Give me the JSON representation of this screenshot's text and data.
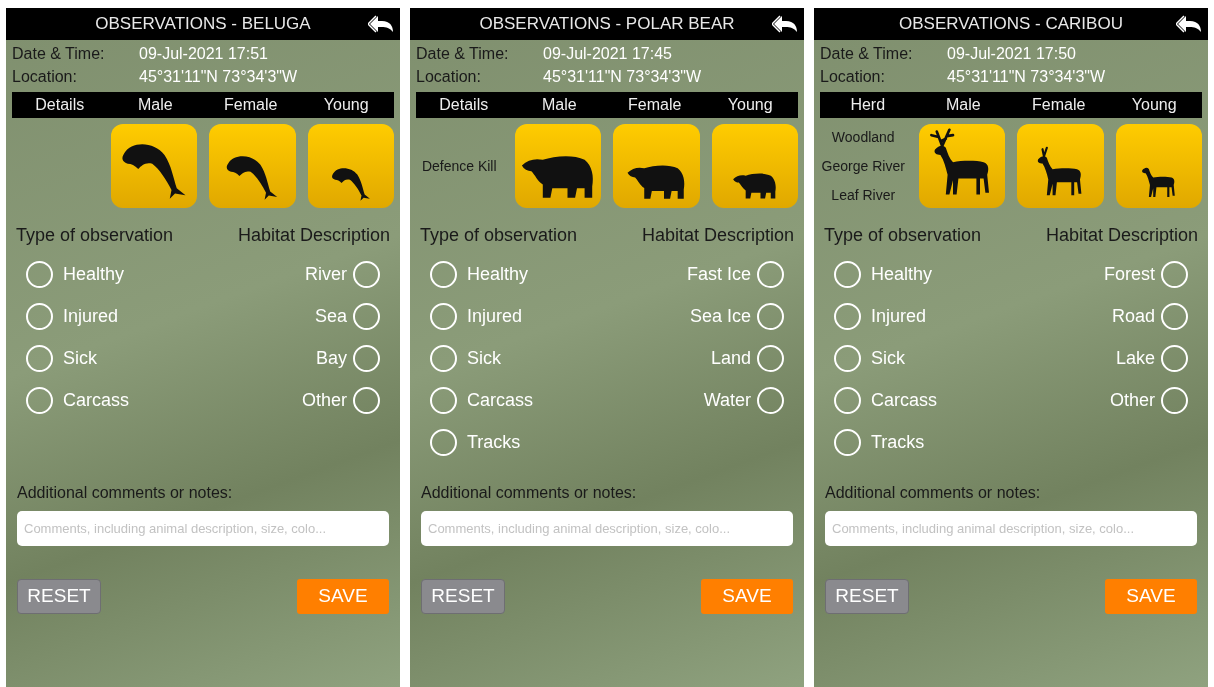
{
  "panels": [
    {
      "title": "OBSERVATIONS - BELUGA",
      "date_label": "Date & Time:",
      "date_value": "09-Jul-2021 17:51",
      "location_label": "Location:",
      "location_value": "45°31'11\"N 73°34'3\"W",
      "columns": [
        "Details",
        "Male",
        "Female",
        "Young"
      ],
      "icons": [
        {
          "kind": "whale"
        },
        {
          "kind": "whale"
        },
        {
          "kind": "whale"
        }
      ],
      "observation_heading": "Type of observation",
      "habitat_heading": "Habitat Description",
      "observation_options": [
        {
          "label": "Healthy",
          "selected": false
        },
        {
          "label": "Injured",
          "selected": false
        },
        {
          "label": "Sick",
          "selected": false
        },
        {
          "label": "Carcass",
          "selected": false
        }
      ],
      "habitat_options": [
        {
          "label": "River",
          "selected": false
        },
        {
          "label": "Sea",
          "selected": false
        },
        {
          "label": "Bay",
          "selected": false
        },
        {
          "label": "Other",
          "selected": false
        }
      ],
      "notes_label": "Additional comments or notes:",
      "notes_placeholder": "Comments, including animal description, size, colo...",
      "reset": "RESET",
      "save": "SAVE"
    },
    {
      "title": "OBSERVATIONS - POLAR BEAR",
      "date_label": "Date & Time:",
      "date_value": "09-Jul-2021 17:45",
      "location_label": "Location:",
      "location_value": "45°31'11\"N 73°34'3\"W",
      "columns": [
        "Details",
        "Male",
        "Female",
        "Young"
      ],
      "details": [
        "Defence Kill"
      ],
      "icons": [
        {
          "kind": "bear"
        },
        {
          "kind": "bear"
        },
        {
          "kind": "bear"
        }
      ],
      "observation_heading": "Type of observation",
      "habitat_heading": "Habitat Description",
      "observation_options": [
        {
          "label": "Healthy",
          "selected": false
        },
        {
          "label": "Injured",
          "selected": false
        },
        {
          "label": "Sick",
          "selected": false
        },
        {
          "label": "Carcass",
          "selected": false
        },
        {
          "label": "Tracks",
          "selected": false
        }
      ],
      "habitat_options": [
        {
          "label": "Fast Ice",
          "selected": false
        },
        {
          "label": "Sea Ice",
          "selected": false
        },
        {
          "label": "Land",
          "selected": false
        },
        {
          "label": "Water",
          "selected": false
        }
      ],
      "notes_label": "Additional comments or notes:",
      "notes_placeholder": "Comments, including animal description, size, colo...",
      "reset": "RESET",
      "save": "SAVE"
    },
    {
      "title": "OBSERVATIONS - CARIBOU",
      "date_label": "Date & Time:",
      "date_value": "09-Jul-2021 17:50",
      "location_label": "Location:",
      "location_value": "45°31'11\"N 73°34'3\"W",
      "columns": [
        "Herd",
        "Male",
        "Female",
        "Young"
      ],
      "details": [
        "Woodland",
        "George River",
        "Leaf River"
      ],
      "icons": [
        {
          "kind": "deer"
        },
        {
          "kind": "deer"
        },
        {
          "kind": "deer"
        }
      ],
      "observation_heading": "Type of observation",
      "habitat_heading": "Habitat Description",
      "observation_options": [
        {
          "label": "Healthy",
          "selected": false
        },
        {
          "label": "Injured",
          "selected": false
        },
        {
          "label": "Sick",
          "selected": false
        },
        {
          "label": "Carcass",
          "selected": false
        },
        {
          "label": "Tracks",
          "selected": false
        }
      ],
      "habitat_options": [
        {
          "label": "Forest",
          "selected": false
        },
        {
          "label": "Road",
          "selected": false
        },
        {
          "label": "Lake",
          "selected": false
        },
        {
          "label": "Other",
          "selected": false
        }
      ],
      "notes_label": "Additional comments or notes:",
      "notes_placeholder": "Comments, including animal description, size, colo...",
      "reset": "RESET",
      "save": "SAVE"
    }
  ]
}
